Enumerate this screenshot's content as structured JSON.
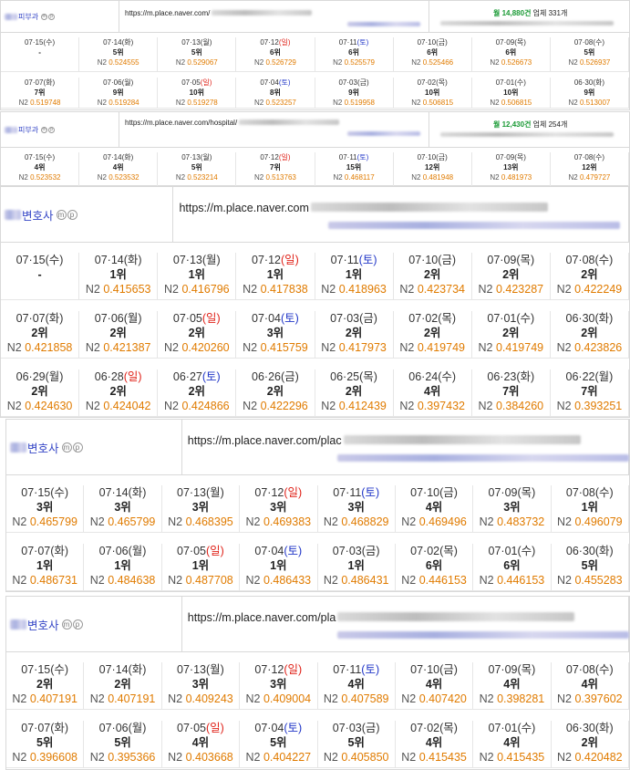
{
  "colors": {
    "accent": "#3445c6",
    "value": "#e07b00",
    "sunday": "#e0241b",
    "saturday": "#2338c8",
    "green": "#1a9a35"
  },
  "sections": [
    {
      "name_suffix": "피부과",
      "url_prefix": "https://m.place.naver.com/",
      "info": {
        "pre": "월 ",
        "count": "14,880건",
        "post": " 업체 331개"
      },
      "rows": [
        [
          {
            "d": "07·15",
            "w": "(수)",
            "r": "-",
            "n": ""
          },
          {
            "d": "07·14",
            "w": "(화)",
            "r": "5위",
            "n": "0.524555"
          },
          {
            "d": "07·13",
            "w": "(월)",
            "r": "5위",
            "n": "0.529067"
          },
          {
            "d": "07·12",
            "w": "(일)",
            "r": "6위",
            "n": "0.526729"
          },
          {
            "d": "07·11",
            "w": "(토)",
            "r": "6위",
            "n": "0.525579"
          },
          {
            "d": "07·10",
            "w": "(금)",
            "r": "6위",
            "n": "0.525466"
          },
          {
            "d": "07·09",
            "w": "(목)",
            "r": "6위",
            "n": "0.526673"
          },
          {
            "d": "07·08",
            "w": "(수)",
            "r": "5위",
            "n": "0.526937"
          }
        ],
        [
          {
            "d": "07·07",
            "w": "(화)",
            "r": "7위",
            "n": "0.519748"
          },
          {
            "d": "07·06",
            "w": "(월)",
            "r": "9위",
            "n": "0.519284"
          },
          {
            "d": "07·05",
            "w": "(일)",
            "r": "10위",
            "n": "0.519278"
          },
          {
            "d": "07·04",
            "w": "(토)",
            "r": "8위",
            "n": "0.523257"
          },
          {
            "d": "07·03",
            "w": "(금)",
            "r": "9위",
            "n": "0.519958"
          },
          {
            "d": "07·02",
            "w": "(목)",
            "r": "10위",
            "n": "0.506815"
          },
          {
            "d": "07·01",
            "w": "(수)",
            "r": "10위",
            "n": "0.506815"
          },
          {
            "d": "06·30",
            "w": "(화)",
            "r": "9위",
            "n": "0.513007"
          }
        ]
      ]
    },
    {
      "name_suffix": "피부과",
      "url_prefix": "https://m.place.naver.com/hospital/",
      "info": {
        "pre": "월 ",
        "count": "12,430건",
        "post": " 업체 254개"
      },
      "rows": [
        [
          {
            "d": "07·15",
            "w": "(수)",
            "r": "4위",
            "n": "0.523532"
          },
          {
            "d": "07·14",
            "w": "(화)",
            "r": "4위",
            "n": "0.523532"
          },
          {
            "d": "07·13",
            "w": "(월)",
            "r": "5위",
            "n": "0.523214"
          },
          {
            "d": "07·12",
            "w": "(일)",
            "r": "7위",
            "n": "0.513763"
          },
          {
            "d": "07·11",
            "w": "(토)",
            "r": "15위",
            "n": "0.468117"
          },
          {
            "d": "07·10",
            "w": "(금)",
            "r": "12위",
            "n": "0.481948"
          },
          {
            "d": "07·09",
            "w": "(목)",
            "r": "13위",
            "n": "0.481973"
          },
          {
            "d": "07·08",
            "w": "(수)",
            "r": "12위",
            "n": "0.479727"
          }
        ]
      ]
    },
    {
      "name_suffix": "변호사",
      "url_prefix": "https://m.place.naver.com",
      "rows": [
        [
          {
            "d": "07·15",
            "w": "(수)",
            "r": "-",
            "n": ""
          },
          {
            "d": "07·14",
            "w": "(화)",
            "r": "1위",
            "n": "0.415653"
          },
          {
            "d": "07·13",
            "w": "(월)",
            "r": "1위",
            "n": "0.416796"
          },
          {
            "d": "07·12",
            "w": "(일)",
            "r": "1위",
            "n": "0.417838"
          },
          {
            "d": "07·11",
            "w": "(토)",
            "r": "1위",
            "n": "0.418963"
          },
          {
            "d": "07·10",
            "w": "(금)",
            "r": "2위",
            "n": "0.423734"
          },
          {
            "d": "07·09",
            "w": "(목)",
            "r": "2위",
            "n": "0.423287"
          },
          {
            "d": "07·08",
            "w": "(수)",
            "r": "2위",
            "n": "0.422249"
          }
        ],
        [
          {
            "d": "07·07",
            "w": "(화)",
            "r": "2위",
            "n": "0.421858"
          },
          {
            "d": "07·06",
            "w": "(월)",
            "r": "2위",
            "n": "0.421387"
          },
          {
            "d": "07·05",
            "w": "(일)",
            "r": "2위",
            "n": "0.420260"
          },
          {
            "d": "07·04",
            "w": "(토)",
            "r": "3위",
            "n": "0.415759"
          },
          {
            "d": "07·03",
            "w": "(금)",
            "r": "2위",
            "n": "0.417973"
          },
          {
            "d": "07·02",
            "w": "(목)",
            "r": "2위",
            "n": "0.419749"
          },
          {
            "d": "07·01",
            "w": "(수)",
            "r": "2위",
            "n": "0.419749"
          },
          {
            "d": "06·30",
            "w": "(화)",
            "r": "2위",
            "n": "0.423826"
          }
        ],
        [
          {
            "d": "06·29",
            "w": "(월)",
            "r": "2위",
            "n": "0.424630"
          },
          {
            "d": "06·28",
            "w": "(일)",
            "r": "2위",
            "n": "0.424042"
          },
          {
            "d": "06·27",
            "w": "(토)",
            "r": "2위",
            "n": "0.424866"
          },
          {
            "d": "06·26",
            "w": "(금)",
            "r": "2위",
            "n": "0.422296"
          },
          {
            "d": "06·25",
            "w": "(목)",
            "r": "2위",
            "n": "0.412439"
          },
          {
            "d": "06·24",
            "w": "(수)",
            "r": "4위",
            "n": "0.397432"
          },
          {
            "d": "06·23",
            "w": "(화)",
            "r": "7위",
            "n": "0.384260"
          },
          {
            "d": "06·22",
            "w": "(월)",
            "r": "7위",
            "n": "0.393251"
          }
        ]
      ]
    },
    {
      "name_suffix": "변호사",
      "url_prefix": "https://m.place.naver.com/plac",
      "rows": [
        [
          {
            "d": "07·15",
            "w": "(수)",
            "r": "3위",
            "n": "0.465799"
          },
          {
            "d": "07·14",
            "w": "(화)",
            "r": "3위",
            "n": "0.465799"
          },
          {
            "d": "07·13",
            "w": "(월)",
            "r": "3위",
            "n": "0.468395"
          },
          {
            "d": "07·12",
            "w": "(일)",
            "r": "3위",
            "n": "0.469383"
          },
          {
            "d": "07·11",
            "w": "(토)",
            "r": "3위",
            "n": "0.468829"
          },
          {
            "d": "07·10",
            "w": "(금)",
            "r": "4위",
            "n": "0.469496"
          },
          {
            "d": "07·09",
            "w": "(목)",
            "r": "3위",
            "n": "0.483732"
          },
          {
            "d": "07·08",
            "w": "(수)",
            "r": "1위",
            "n": "0.496079"
          }
        ],
        [
          {
            "d": "07·07",
            "w": "(화)",
            "r": "1위",
            "n": "0.486731"
          },
          {
            "d": "07·06",
            "w": "(월)",
            "r": "1위",
            "n": "0.484638"
          },
          {
            "d": "07·05",
            "w": "(일)",
            "r": "1위",
            "n": "0.487708"
          },
          {
            "d": "07·04",
            "w": "(토)",
            "r": "1위",
            "n": "0.486433"
          },
          {
            "d": "07·03",
            "w": "(금)",
            "r": "1위",
            "n": "0.486431"
          },
          {
            "d": "07·02",
            "w": "(목)",
            "r": "6위",
            "n": "0.446153"
          },
          {
            "d": "07·01",
            "w": "(수)",
            "r": "6위",
            "n": "0.446153"
          },
          {
            "d": "06·30",
            "w": "(화)",
            "r": "5위",
            "n": "0.455283"
          }
        ]
      ]
    },
    {
      "name_suffix": "변호사",
      "url_prefix": "https://m.place.naver.com/pla",
      "rows": [
        [
          {
            "d": "07·15",
            "w": "(수)",
            "r": "2위",
            "n": "0.407191"
          },
          {
            "d": "07·14",
            "w": "(화)",
            "r": "2위",
            "n": "0.407191"
          },
          {
            "d": "07·13",
            "w": "(월)",
            "r": "3위",
            "n": "0.409243"
          },
          {
            "d": "07·12",
            "w": "(일)",
            "r": "3위",
            "n": "0.409004"
          },
          {
            "d": "07·11",
            "w": "(토)",
            "r": "4위",
            "n": "0.407589"
          },
          {
            "d": "07·10",
            "w": "(금)",
            "r": "4위",
            "n": "0.407420"
          },
          {
            "d": "07·09",
            "w": "(목)",
            "r": "4위",
            "n": "0.398281"
          },
          {
            "d": "07·08",
            "w": "(수)",
            "r": "4위",
            "n": "0.397602"
          }
        ],
        [
          {
            "d": "07·07",
            "w": "(화)",
            "r": "5위",
            "n": "0.396608"
          },
          {
            "d": "07·06",
            "w": "(월)",
            "r": "5위",
            "n": "0.395366"
          },
          {
            "d": "07·05",
            "w": "(일)",
            "r": "4위",
            "n": "0.403668"
          },
          {
            "d": "07·04",
            "w": "(토)",
            "r": "5위",
            "n": "0.404227"
          },
          {
            "d": "07·03",
            "w": "(금)",
            "r": "5위",
            "n": "0.405850"
          },
          {
            "d": "07·02",
            "w": "(목)",
            "r": "4위",
            "n": "0.415435"
          },
          {
            "d": "07·01",
            "w": "(수)",
            "r": "4위",
            "n": "0.415435"
          },
          {
            "d": "06·30",
            "w": "(화)",
            "r": "2위",
            "n": "0.420482"
          }
        ]
      ]
    }
  ],
  "labels": {
    "n2": "N2 ",
    "m": "m",
    "p": "p"
  }
}
